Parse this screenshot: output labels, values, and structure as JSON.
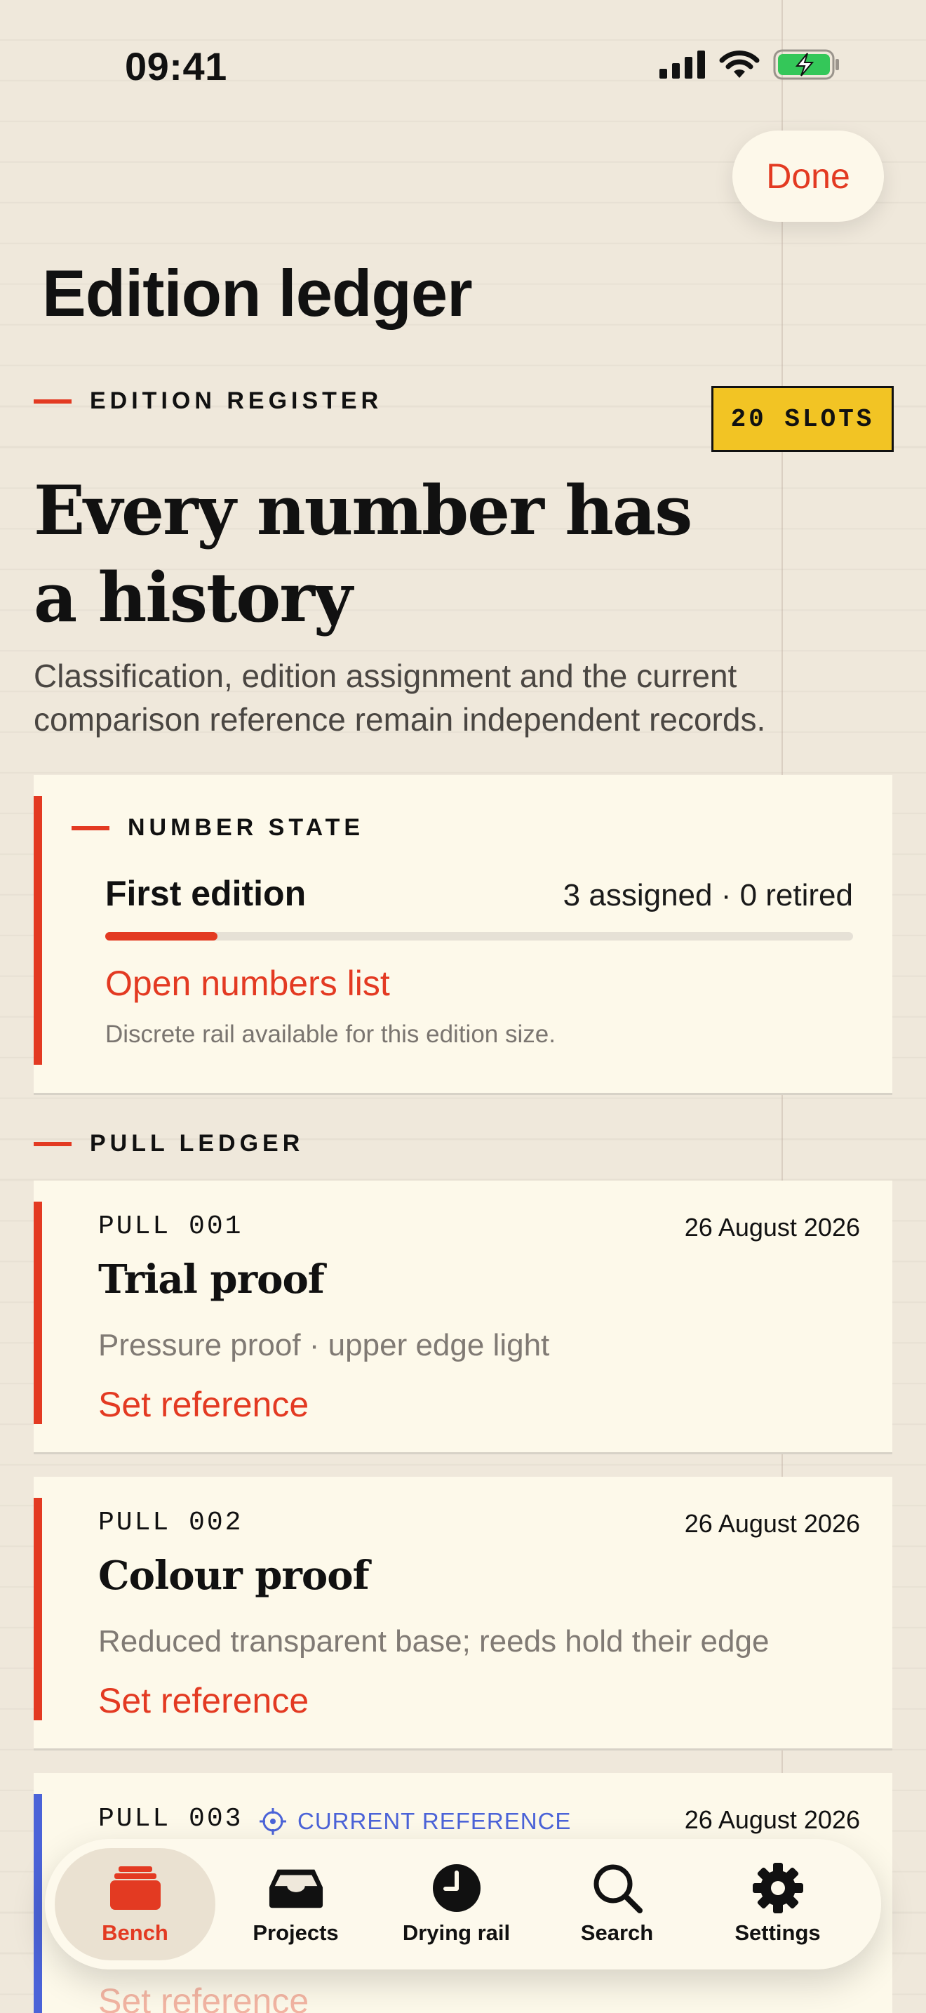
{
  "status_bar": {
    "time": "09:41"
  },
  "header": {
    "done_label": "Done",
    "title": "Edition ledger"
  },
  "register": {
    "eyebrow": "EDITION REGISTER",
    "slots_badge": "20 SLOTS",
    "headline_line1": "Every number has",
    "headline_line2": "a history",
    "subtitle": "Classification, edition assignment and the current comparison reference remain independent records."
  },
  "number_state": {
    "eyebrow": "NUMBER STATE",
    "label": "First edition",
    "counts": "3 assigned · 0 retired",
    "progress_fraction": 0.15,
    "link": "Open numbers list",
    "note": "Discrete rail available for this edition size."
  },
  "pull_ledger": {
    "eyebrow": "PULL LEDGER",
    "pulls": [
      {
        "id": "PULL 001",
        "date": "26 August 2026",
        "title": "Trial proof",
        "description": "Pressure proof · upper edge light",
        "action": "Set reference"
      },
      {
        "id": "PULL 002",
        "date": "26 August 2026",
        "title": "Colour proof",
        "description": "Reduced transparent base; reeds hold their edge",
        "action": "Set reference"
      },
      {
        "id": "PULL 003",
        "date": "26 August 2026",
        "reference_tag": "CURRENT REFERENCE",
        "action": "Set reference"
      }
    ]
  },
  "tab_bar": {
    "tabs": [
      {
        "label": "Bench",
        "icon": "bench-tray-icon",
        "active": true
      },
      {
        "label": "Projects",
        "icon": "inbox-tray-icon"
      },
      {
        "label": "Drying rail",
        "icon": "clock-icon"
      },
      {
        "label": "Search",
        "icon": "search-icon"
      },
      {
        "label": "Settings",
        "icon": "gear-icon"
      }
    ]
  },
  "colors": {
    "accent": "#e33a22",
    "reference_blue": "#4b63d8",
    "badge_yellow": "#f2c424",
    "paper": "#efe8db",
    "card": "#fdf9ea"
  }
}
